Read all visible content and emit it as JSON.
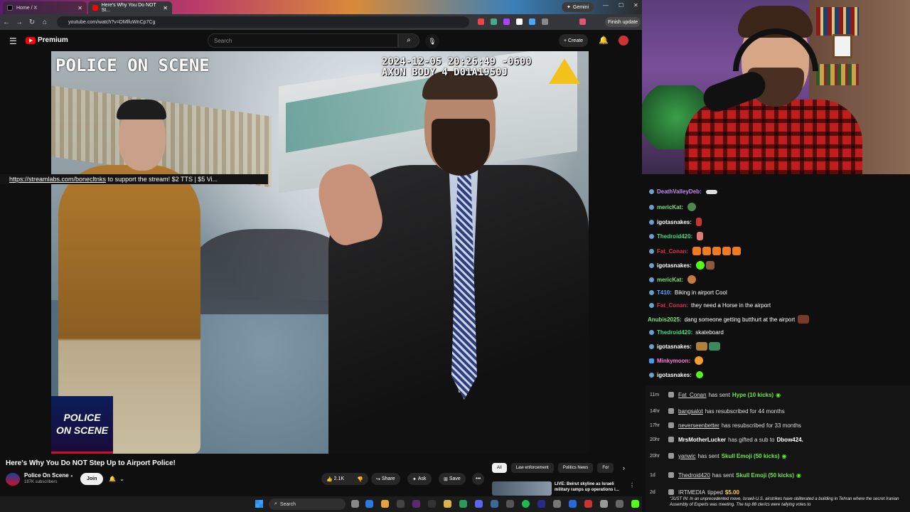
{
  "browser": {
    "tabs": [
      {
        "label": "Home / X"
      },
      {
        "label": "Here's Why You Do NOT St..."
      }
    ],
    "gemini_label": "Gemini",
    "url": "youtube.com/watch?v=DMlfuWnCp7Cg",
    "finish_update": "Finish update"
  },
  "youtube": {
    "logo_text": "Premium",
    "search_placeholder": "Search",
    "create_label": "Create"
  },
  "video": {
    "overlay_title": "POLICE ON SCENE",
    "timestamp_line1": "2024-12-05 20:26:49 -0600",
    "timestamp_line2": "AXON BODY 4 D01A1950J",
    "badge_line1": "POLICE",
    "badge_line2": "ON SCENE",
    "title": "Here's Why You Do NOT Step Up to Airport Police!",
    "channel": "Police On Scene",
    "subscribers": "187K subscribers",
    "join_label": "Join",
    "likes": "2.1K",
    "share_label": "Share",
    "ask_label": "Ask",
    "save_label": "Save"
  },
  "chips": [
    "All",
    "Law enforcement",
    "Politics News",
    "For"
  ],
  "recommendation": {
    "title": "LIVE: Beirut skyline as Israeli military ramps up operations i..."
  },
  "taskbar": {
    "search_label": "Search"
  },
  "stream": {
    "ticker_link": "https://streamlabs.com/bonecltnks",
    "ticker_text": " to support the stream! $2 TTS | $5 Vi..."
  },
  "chat": [
    {
      "user": "DeathValleyDeb:",
      "text": "",
      "color": "#c58af9"
    },
    {
      "user": "mericKat:",
      "text": "",
      "color": "#7fe07f"
    },
    {
      "user": "igotasnakes:",
      "text": "",
      "color": "#ffffff"
    },
    {
      "user": "Thedroid420:",
      "text": "",
      "color": "#3ddc84"
    },
    {
      "user": "Fat_Conan:",
      "text": "",
      "color": "#d6334a"
    },
    {
      "user": "igotasnakes:",
      "text": "",
      "color": "#ffffff"
    },
    {
      "user": "mericKat:",
      "text": "",
      "color": "#7fe07f"
    },
    {
      "user": "T410:",
      "text": "Biking in airport Cool",
      "color": "#5aa0ff"
    },
    {
      "user": "Fat_Conan:",
      "text": "they need a Horse in the airport",
      "color": "#d6334a"
    },
    {
      "user": "Anubis2025:",
      "text": "dang someone getting butthurt at the airport",
      "color": "#7fe07f"
    },
    {
      "user": "Thedroid420:",
      "text": "skateboard",
      "color": "#3ddc84"
    },
    {
      "user": "igotasnakes:",
      "text": "",
      "color": "#ffffff"
    },
    {
      "user": "Minkymoon:",
      "text": "",
      "color": "#ff7ad9"
    },
    {
      "user": "igotasnakes:",
      "text": "",
      "color": "#ffffff"
    }
  ],
  "events": [
    {
      "time": "11m",
      "name": "Fat_Conan",
      "pre": "has sent",
      "hl": "Hype (10 kicks)",
      "post": ""
    },
    {
      "time": "14hr",
      "name": "bangsalot",
      "pre": "has resubscribed for 44 months",
      "hl": "",
      "post": ""
    },
    {
      "time": "17hr",
      "name": "neverseenbetter",
      "pre": "has resubscribed for 33 months",
      "hl": "",
      "post": ""
    },
    {
      "time": "20hr",
      "name": "MrsMotherLucker",
      "pre": "has gifted a sub to",
      "hl": "",
      "post": "Dbow424."
    },
    {
      "time": "20hr",
      "name": "yanwic",
      "pre": "has sent",
      "hl": "Skull Emoji (50 kicks)",
      "post": ""
    },
    {
      "time": "1d",
      "name": "Thedroid420",
      "pre": "has sent",
      "hl": "Skull Emoji (50 kicks)",
      "post": ""
    },
    {
      "time": "2d",
      "name": "IRTMEDIA",
      "pre": "tipped",
      "hl": "$5.00",
      "post": ""
    }
  ],
  "news_text": "\"JUST IN: In an unprecedented move, Israeli-U.S. airstrikes have obliterated a building in Tehran where the secret Iranian Assembly of Experts was meeting. The top 88 clerics were tallying votes to"
}
